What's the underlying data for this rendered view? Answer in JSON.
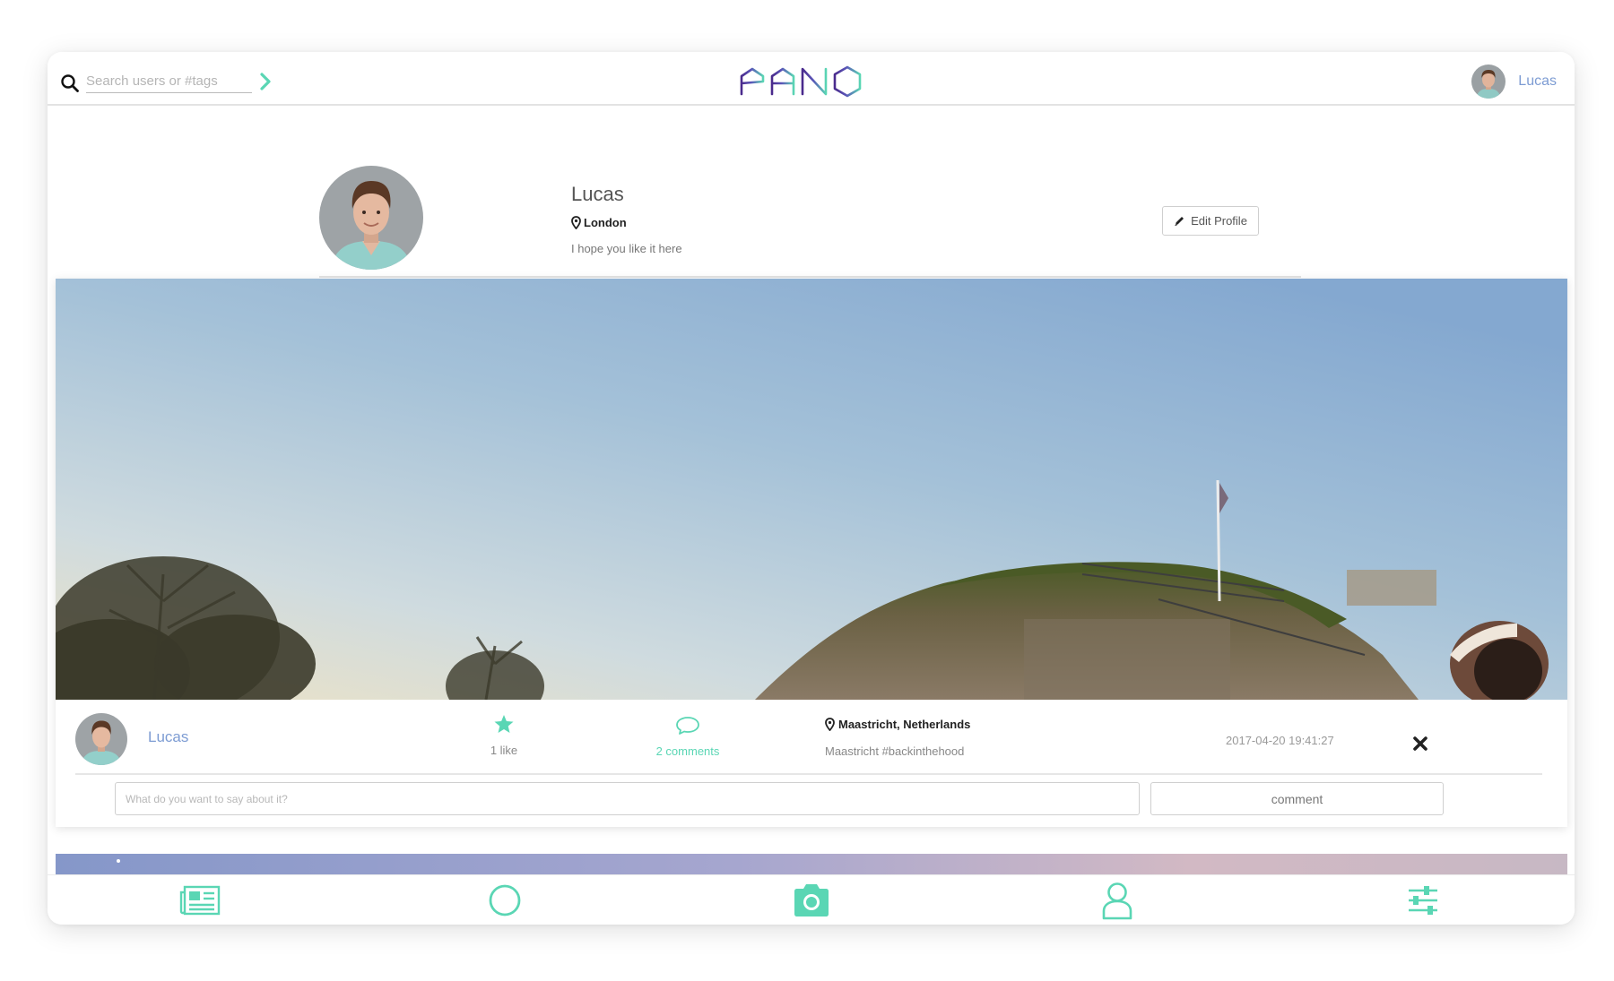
{
  "app": {
    "logo_text": "PANO",
    "accent_color": "#5ad6b4",
    "link_color": "#7d9cd3"
  },
  "search": {
    "placeholder": "Search users or #tags",
    "icon": "search-icon",
    "go_icon": "chevron-right-icon"
  },
  "header_user": {
    "name": "Lucas"
  },
  "profile": {
    "name": "Lucas",
    "location": "London",
    "bio": "I hope you like it here",
    "edit_label": "Edit Profile",
    "tabs": [
      {
        "icon": "image-icon",
        "active": true
      },
      {
        "icon": "folder-icon",
        "active": false
      },
      {
        "icon": "group-icon",
        "active": false
      },
      {
        "icon": "circle-icon",
        "active": false
      }
    ]
  },
  "post": {
    "user": "Lucas",
    "likes": "1 like",
    "comments": "2 comments",
    "location": "Maastricht, Netherlands",
    "caption": "Maastricht #backinthehood",
    "timestamp": "2017-04-20 19:41:27",
    "comment_placeholder": "What do you want to say about it?",
    "comment_button": "comment"
  },
  "bottom_nav": [
    {
      "icon": "newspaper-icon"
    },
    {
      "icon": "circle-icon"
    },
    {
      "icon": "camera-icon"
    },
    {
      "icon": "user-icon"
    },
    {
      "icon": "sliders-icon"
    }
  ]
}
